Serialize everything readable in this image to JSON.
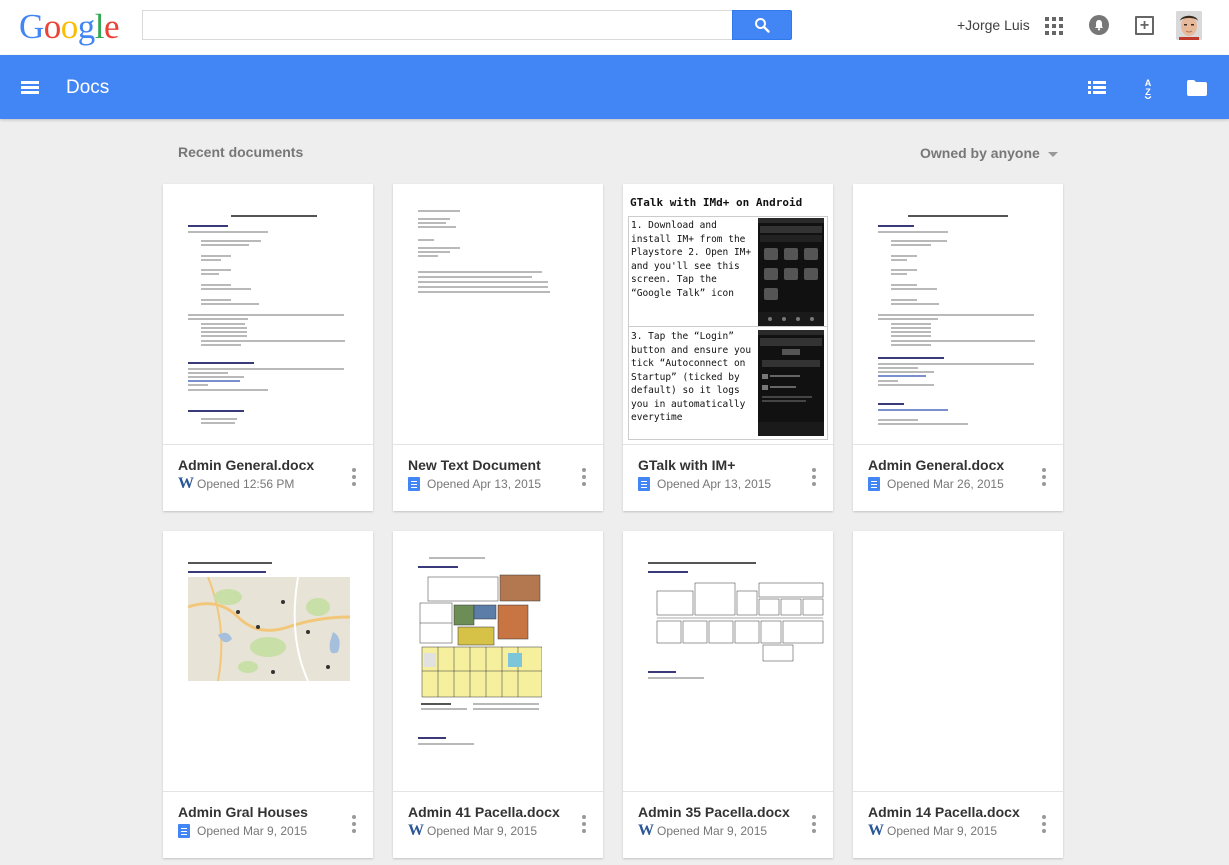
{
  "header": {
    "logo_text": "Google",
    "user_name": "+Jorge Luis"
  },
  "appbar": {
    "title": "Docs"
  },
  "main": {
    "section_title": "Recent documents",
    "owner_filter": "Owned by anyone"
  },
  "documents": [
    {
      "title": "Admin General.docx",
      "meta": "Opened  12:56 PM",
      "icon": "word-icon",
      "thumb": "doc-text"
    },
    {
      "title": "New Text Document",
      "meta": "Opened  Apr 13, 2015",
      "icon": "gdoc-icon",
      "thumb": "doc-code"
    },
    {
      "title": "GTalk with IM+",
      "meta": "Opened  Apr 13, 2015",
      "icon": "gdoc-icon",
      "thumb": "gtalk",
      "thumb_text": {
        "heading": "GTalk with IMd+ on Android",
        "step1": "1. Download and install IM+ from the Playstore 2. Open IM+ and you'll see this screen. Tap the “Google Talk” icon",
        "step3": "3. Tap the “Login” button and ensure you tick “Autoconnect on Startup” (ticked by default) so it logs you in automatically everytime"
      }
    },
    {
      "title": "Admin General.docx",
      "meta": "Opened  Mar 26, 2015",
      "icon": "gdoc-icon",
      "thumb": "doc-text"
    },
    {
      "title": "Admin Gral Houses",
      "meta": "Opened  Mar 9, 2015",
      "icon": "gdoc-icon",
      "thumb": "map"
    },
    {
      "title": "Admin 41 Pacella.docx",
      "meta": "Opened  Mar 9, 2015",
      "icon": "word-icon",
      "thumb": "floorplan-color"
    },
    {
      "title": "Admin 35 Pacella.docx",
      "meta": "Opened  Mar 9, 2015",
      "icon": "word-icon",
      "thumb": "floorplan"
    },
    {
      "title": "Admin 14 Pacella.docx",
      "meta": "Opened  Mar 9, 2015",
      "icon": "word-icon",
      "thumb": "blank"
    }
  ],
  "colors": {
    "brand_blue": "#4285f4",
    "background": "#eeeeee",
    "word_blue": "#2b5797"
  }
}
